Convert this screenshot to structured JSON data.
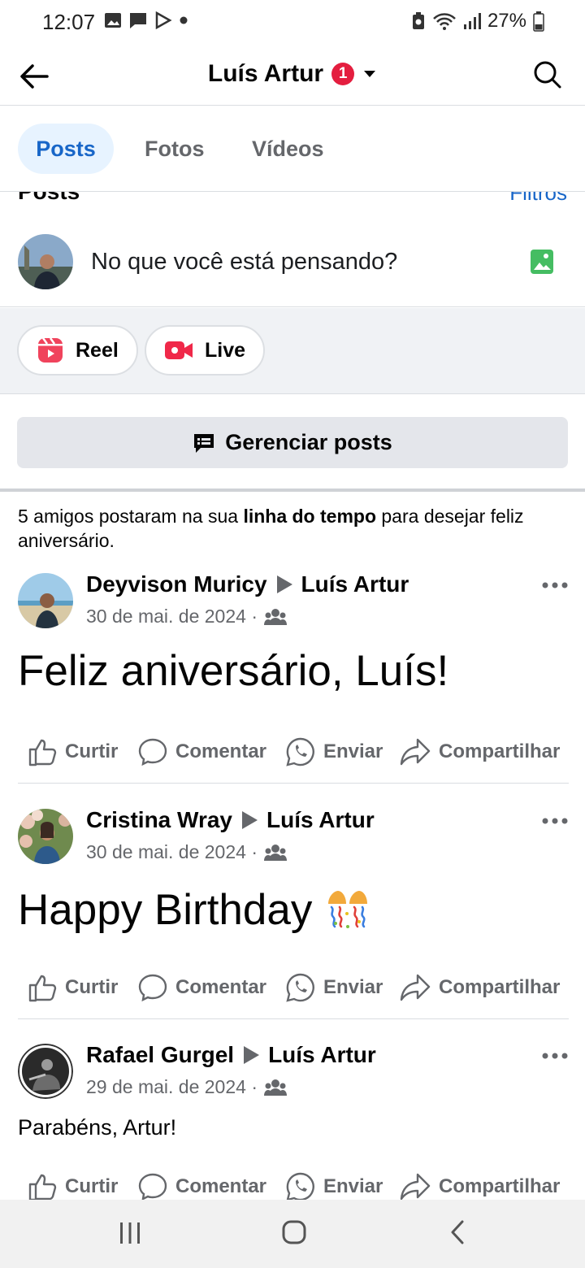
{
  "status_bar": {
    "time": "12:07",
    "battery": "27%"
  },
  "header": {
    "name": "Luís Artur",
    "badge": "1"
  },
  "tabs": [
    {
      "label": "Posts",
      "active": true
    },
    {
      "label": "Fotos"
    },
    {
      "label": "Vídeos"
    }
  ],
  "section": {
    "title": "Posts",
    "filters": "Filtros"
  },
  "composer": {
    "prompt": "No que você está pensando?"
  },
  "quick_actions": [
    {
      "label": "Reel"
    },
    {
      "label": "Live"
    }
  ],
  "manage_button": "Gerenciar posts",
  "notice": {
    "prefix": "5 amigos postaram na sua ",
    "bold": "linha do tempo",
    "suffix": " para desejar feliz aniversário."
  },
  "posts": [
    {
      "author": "Deyvison Muricy",
      "target": "Luís Artur",
      "date": "30 de mai. de 2024 ·",
      "text": "Feliz aniversário, Luís!"
    },
    {
      "author": "Cristina Wray",
      "target": "Luís Artur",
      "date": "30 de mai. de 2024 ·",
      "text": "Happy Birthday"
    },
    {
      "author": "Rafael Gurgel",
      "target": "Luís Artur",
      "date": "29 de mai. de 2024 ·",
      "text": "Parabéns, Artur!"
    }
  ],
  "reaction_labels": {
    "like": "Curtir",
    "comment": "Comentar",
    "send": "Enviar",
    "share": "Compartilhar"
  },
  "colors": {
    "accent": "#1866c8",
    "badge": "#e41e3f",
    "secondary_text": "#65676b"
  }
}
